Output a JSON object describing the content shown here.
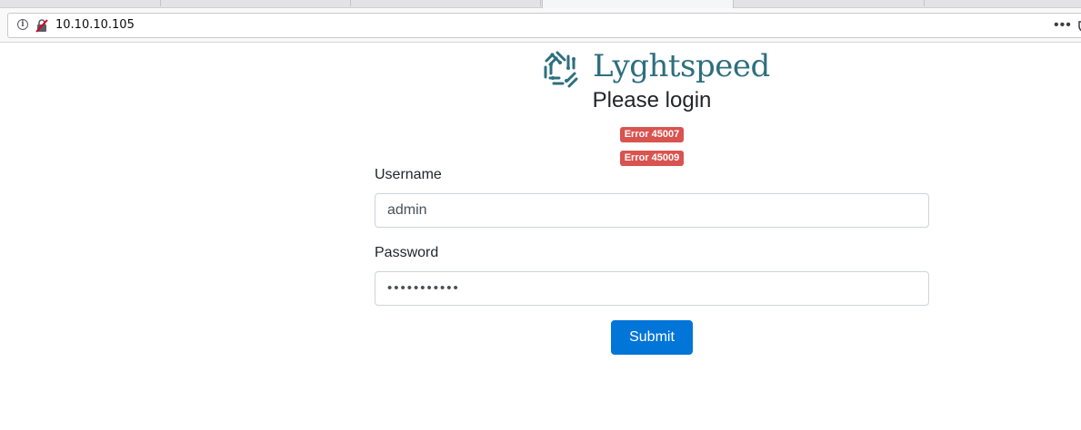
{
  "browser": {
    "url": "10.10.10.105",
    "icons": [
      "info-icon",
      "insecure-connection-icon",
      "more-actions-icon",
      "pocket-icon"
    ]
  },
  "brand": {
    "name": "Lyghtspeed",
    "color": "#2e6f7e"
  },
  "login": {
    "title": "Please login",
    "errors": [
      "Error 45007",
      "Error 45009"
    ],
    "error_color": "#d9534f",
    "username_label": "Username",
    "username_value": "admin",
    "password_label": "Password",
    "password_value": "•••••••••••",
    "submit_label": "Submit",
    "submit_color": "#0275d8"
  }
}
